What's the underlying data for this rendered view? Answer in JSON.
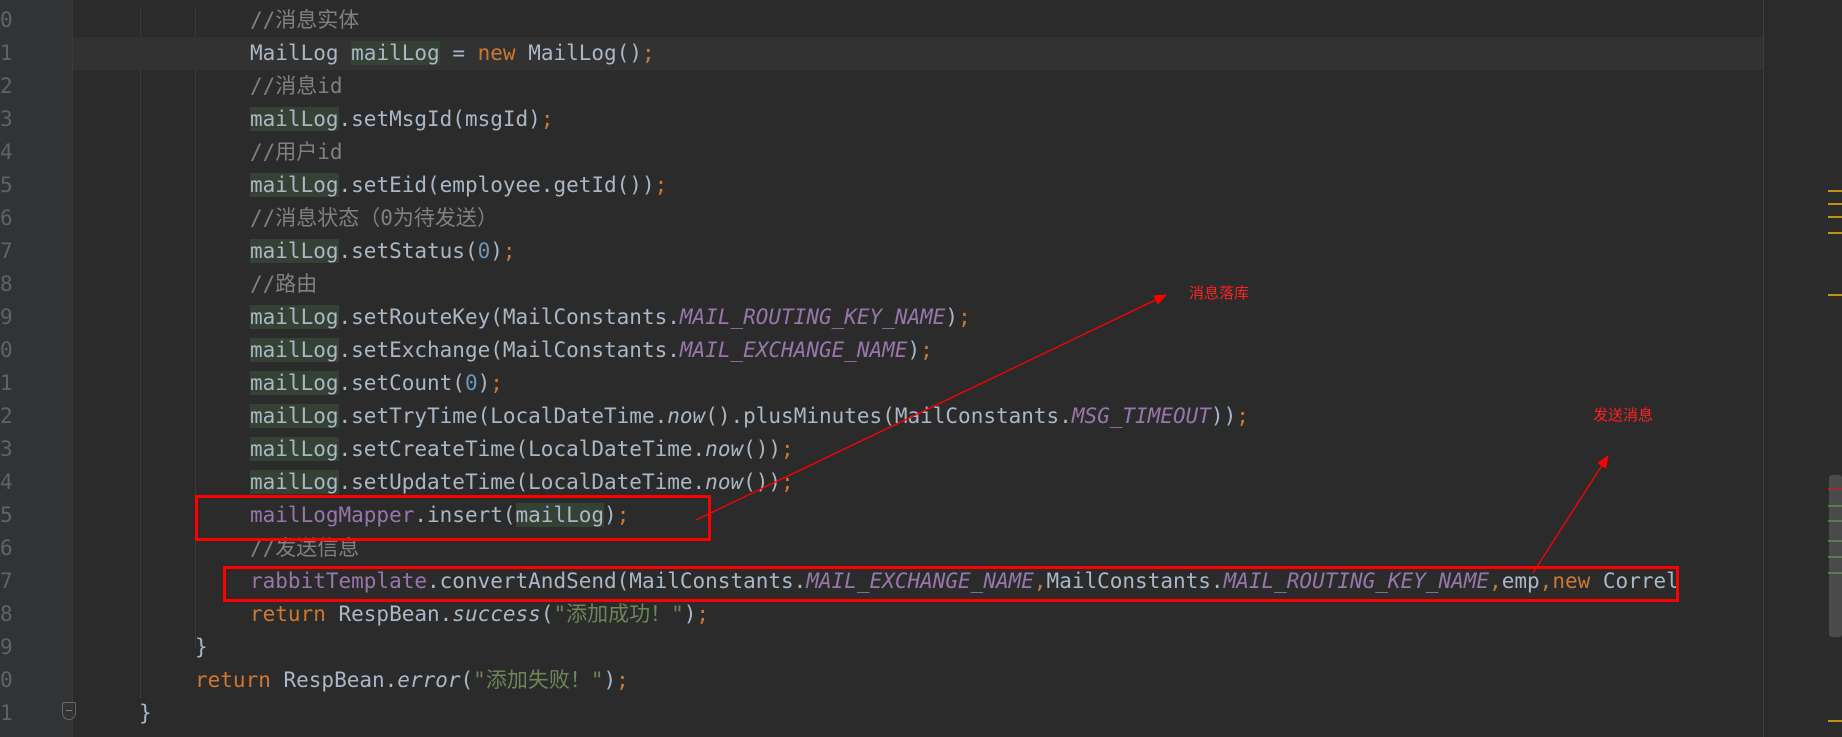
{
  "editor": {
    "line_numbers": [
      "0",
      "1",
      "2",
      "3",
      "4",
      "5",
      "6",
      "7",
      "8",
      "9",
      "0",
      "1",
      "2",
      "3",
      "4",
      "5",
      "6",
      "7",
      "8",
      "9",
      "0",
      "1"
    ],
    "lines": [
      [
        {
          "t": "//消息实体",
          "c": "cmt"
        }
      ],
      [
        {
          "t": "MailLog "
        },
        {
          "t": "mailLog",
          "c": "hl"
        },
        {
          "t": " = "
        },
        {
          "t": "new",
          "c": "kw"
        },
        {
          "t": " MailLog()"
        },
        {
          "t": ";",
          "c": "kw"
        }
      ],
      [
        {
          "t": "//消息id",
          "c": "cmt"
        }
      ],
      [
        {
          "t": "mailLog",
          "c": "hl"
        },
        {
          "t": ".setMsgId(msgId)"
        },
        {
          "t": ";",
          "c": "kw"
        }
      ],
      [
        {
          "t": "//用户id",
          "c": "cmt"
        }
      ],
      [
        {
          "t": "mailLog",
          "c": "hl"
        },
        {
          "t": ".setEid(employee.getId())"
        },
        {
          "t": ";",
          "c": "kw"
        }
      ],
      [
        {
          "t": "//消息状态（0为待发送）",
          "c": "cmt"
        }
      ],
      [
        {
          "t": "mailLog",
          "c": "hl"
        },
        {
          "t": ".setStatus("
        },
        {
          "t": "0",
          "c": "num"
        },
        {
          "t": ")"
        },
        {
          "t": ";",
          "c": "kw"
        }
      ],
      [
        {
          "t": "//路由",
          "c": "cmt"
        }
      ],
      [
        {
          "t": "mailLog",
          "c": "hl"
        },
        {
          "t": ".setRouteKey(MailConstants."
        },
        {
          "t": "MAIL_ROUTING_KEY_NAME",
          "c": "fld"
        },
        {
          "t": ")"
        },
        {
          "t": ";",
          "c": "kw"
        }
      ],
      [
        {
          "t": "mailLog",
          "c": "hl"
        },
        {
          "t": ".setExchange(MailConstants."
        },
        {
          "t": "MAIL_EXCHANGE_NAME",
          "c": "fld"
        },
        {
          "t": ")"
        },
        {
          "t": ";",
          "c": "kw"
        }
      ],
      [
        {
          "t": "mailLog",
          "c": "hl"
        },
        {
          "t": ".setCount("
        },
        {
          "t": "0",
          "c": "num"
        },
        {
          "t": ")"
        },
        {
          "t": ";",
          "c": "kw"
        }
      ],
      [
        {
          "t": "mailLog",
          "c": "hl"
        },
        {
          "t": ".setTryTime(LocalDateTime."
        },
        {
          "t": "now",
          "c": "it"
        },
        {
          "t": "().plusMinutes(MailConstants."
        },
        {
          "t": "MSG_TIMEOUT",
          "c": "fld"
        },
        {
          "t": "))"
        },
        {
          "t": ";",
          "c": "kw"
        }
      ],
      [
        {
          "t": "mailLog",
          "c": "hl"
        },
        {
          "t": ".setCreateTime(LocalDateTime."
        },
        {
          "t": "now",
          "c": "it"
        },
        {
          "t": "())"
        },
        {
          "t": ";",
          "c": "kw"
        }
      ],
      [
        {
          "t": "mailLog",
          "c": "hl"
        },
        {
          "t": ".setUpdateTime(LocalDateTime."
        },
        {
          "t": "now",
          "c": "it"
        },
        {
          "t": "())"
        },
        {
          "t": ";",
          "c": "kw"
        }
      ],
      [
        {
          "t": "mailLogMapper",
          "c": "ifld"
        },
        {
          "t": ".insert("
        },
        {
          "t": "mailLog",
          "c": "hl"
        },
        {
          "t": ")"
        },
        {
          "t": ";",
          "c": "kw"
        }
      ],
      [
        {
          "t": "//发送信息",
          "c": "cmt"
        }
      ],
      [
        {
          "t": "rabbitTemplate",
          "c": "ifld"
        },
        {
          "t": ".convertAndSend(MailConstants."
        },
        {
          "t": "MAIL_EXCHANGE_NAME",
          "c": "fld"
        },
        {
          "t": ",",
          "c": "kw"
        },
        {
          "t": "MailConstants."
        },
        {
          "t": "MAIL_ROUTING_KEY_NAME",
          "c": "fld"
        },
        {
          "t": ",",
          "c": "kw"
        },
        {
          "t": "emp"
        },
        {
          "t": ",",
          "c": "kw"
        },
        {
          "t": "new",
          "c": "kw"
        },
        {
          "t": " Correl"
        }
      ],
      [
        {
          "t": "return",
          "c": "kw"
        },
        {
          "t": " RespBean."
        },
        {
          "t": "success",
          "c": "it"
        },
        {
          "t": "("
        },
        {
          "t": "\"添加成功！\"",
          "c": "str"
        },
        {
          "t": ")"
        },
        {
          "t": ";",
          "c": "kw"
        }
      ],
      [
        {
          "t": "}"
        }
      ],
      [
        {
          "t": "return",
          "c": "kw"
        },
        {
          "t": " RespBean."
        },
        {
          "t": "error",
          "c": "it"
        },
        {
          "t": "("
        },
        {
          "t": "\"添加失败！\"",
          "c": "str"
        },
        {
          "t": ")"
        },
        {
          "t": ";",
          "c": "kw"
        }
      ],
      [
        {
          "t": "}"
        }
      ]
    ]
  },
  "annotations": {
    "persist_label": "消息落库",
    "send_label": "发送消息",
    "color": "#ff0000"
  },
  "theme": {
    "background": "#2b2b2b",
    "keyword": "#cc7832",
    "comment": "#808080",
    "field": "#9876aa",
    "string": "#6a8759",
    "number": "#6897bb"
  }
}
